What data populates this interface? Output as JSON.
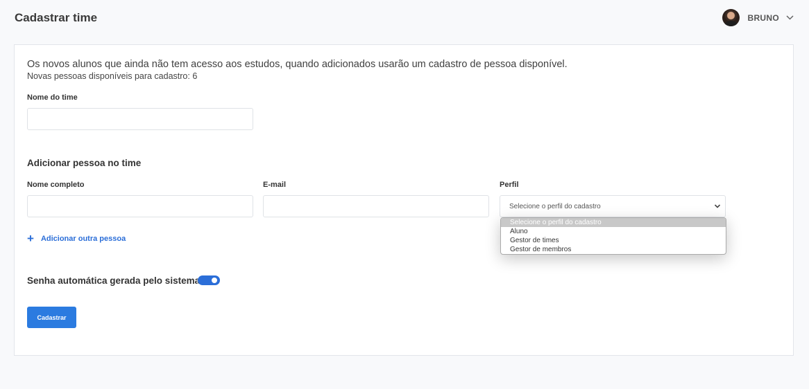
{
  "header": {
    "title": "Cadastrar time",
    "user_name": "BRUNO"
  },
  "info": {
    "line1": "Os novos alunos que ainda não tem acesso aos estudos, quando adicionados usarão um cadastro de pessoa disponível.",
    "line2": "Novas pessoas disponíveis para cadastro: 6"
  },
  "team_form": {
    "team_name_label": "Nome do time",
    "team_name_value": ""
  },
  "add_person": {
    "section_title": "Adicionar pessoa no time",
    "full_name_label": "Nome completo",
    "full_name_value": "",
    "email_label": "E-mail",
    "email_value": "",
    "profile_label": "Perfil",
    "profile_selected": "Selecione o perfil do cadastro",
    "profile_options": [
      "Selecione o perfil do cadastro",
      "Aluno",
      "Gestor de times",
      "Gestor de membros"
    ],
    "add_another_label": "Adicionar outra pessoa",
    "add_another_icon": "plus-icon"
  },
  "password": {
    "label": "Senha automática gerada pelo sistema",
    "enabled": true
  },
  "actions": {
    "submit_label": "Cadastrar"
  },
  "colors": {
    "accent": "#2b7be0",
    "link": "#2b6ed8",
    "background": "#f8f9fb"
  }
}
